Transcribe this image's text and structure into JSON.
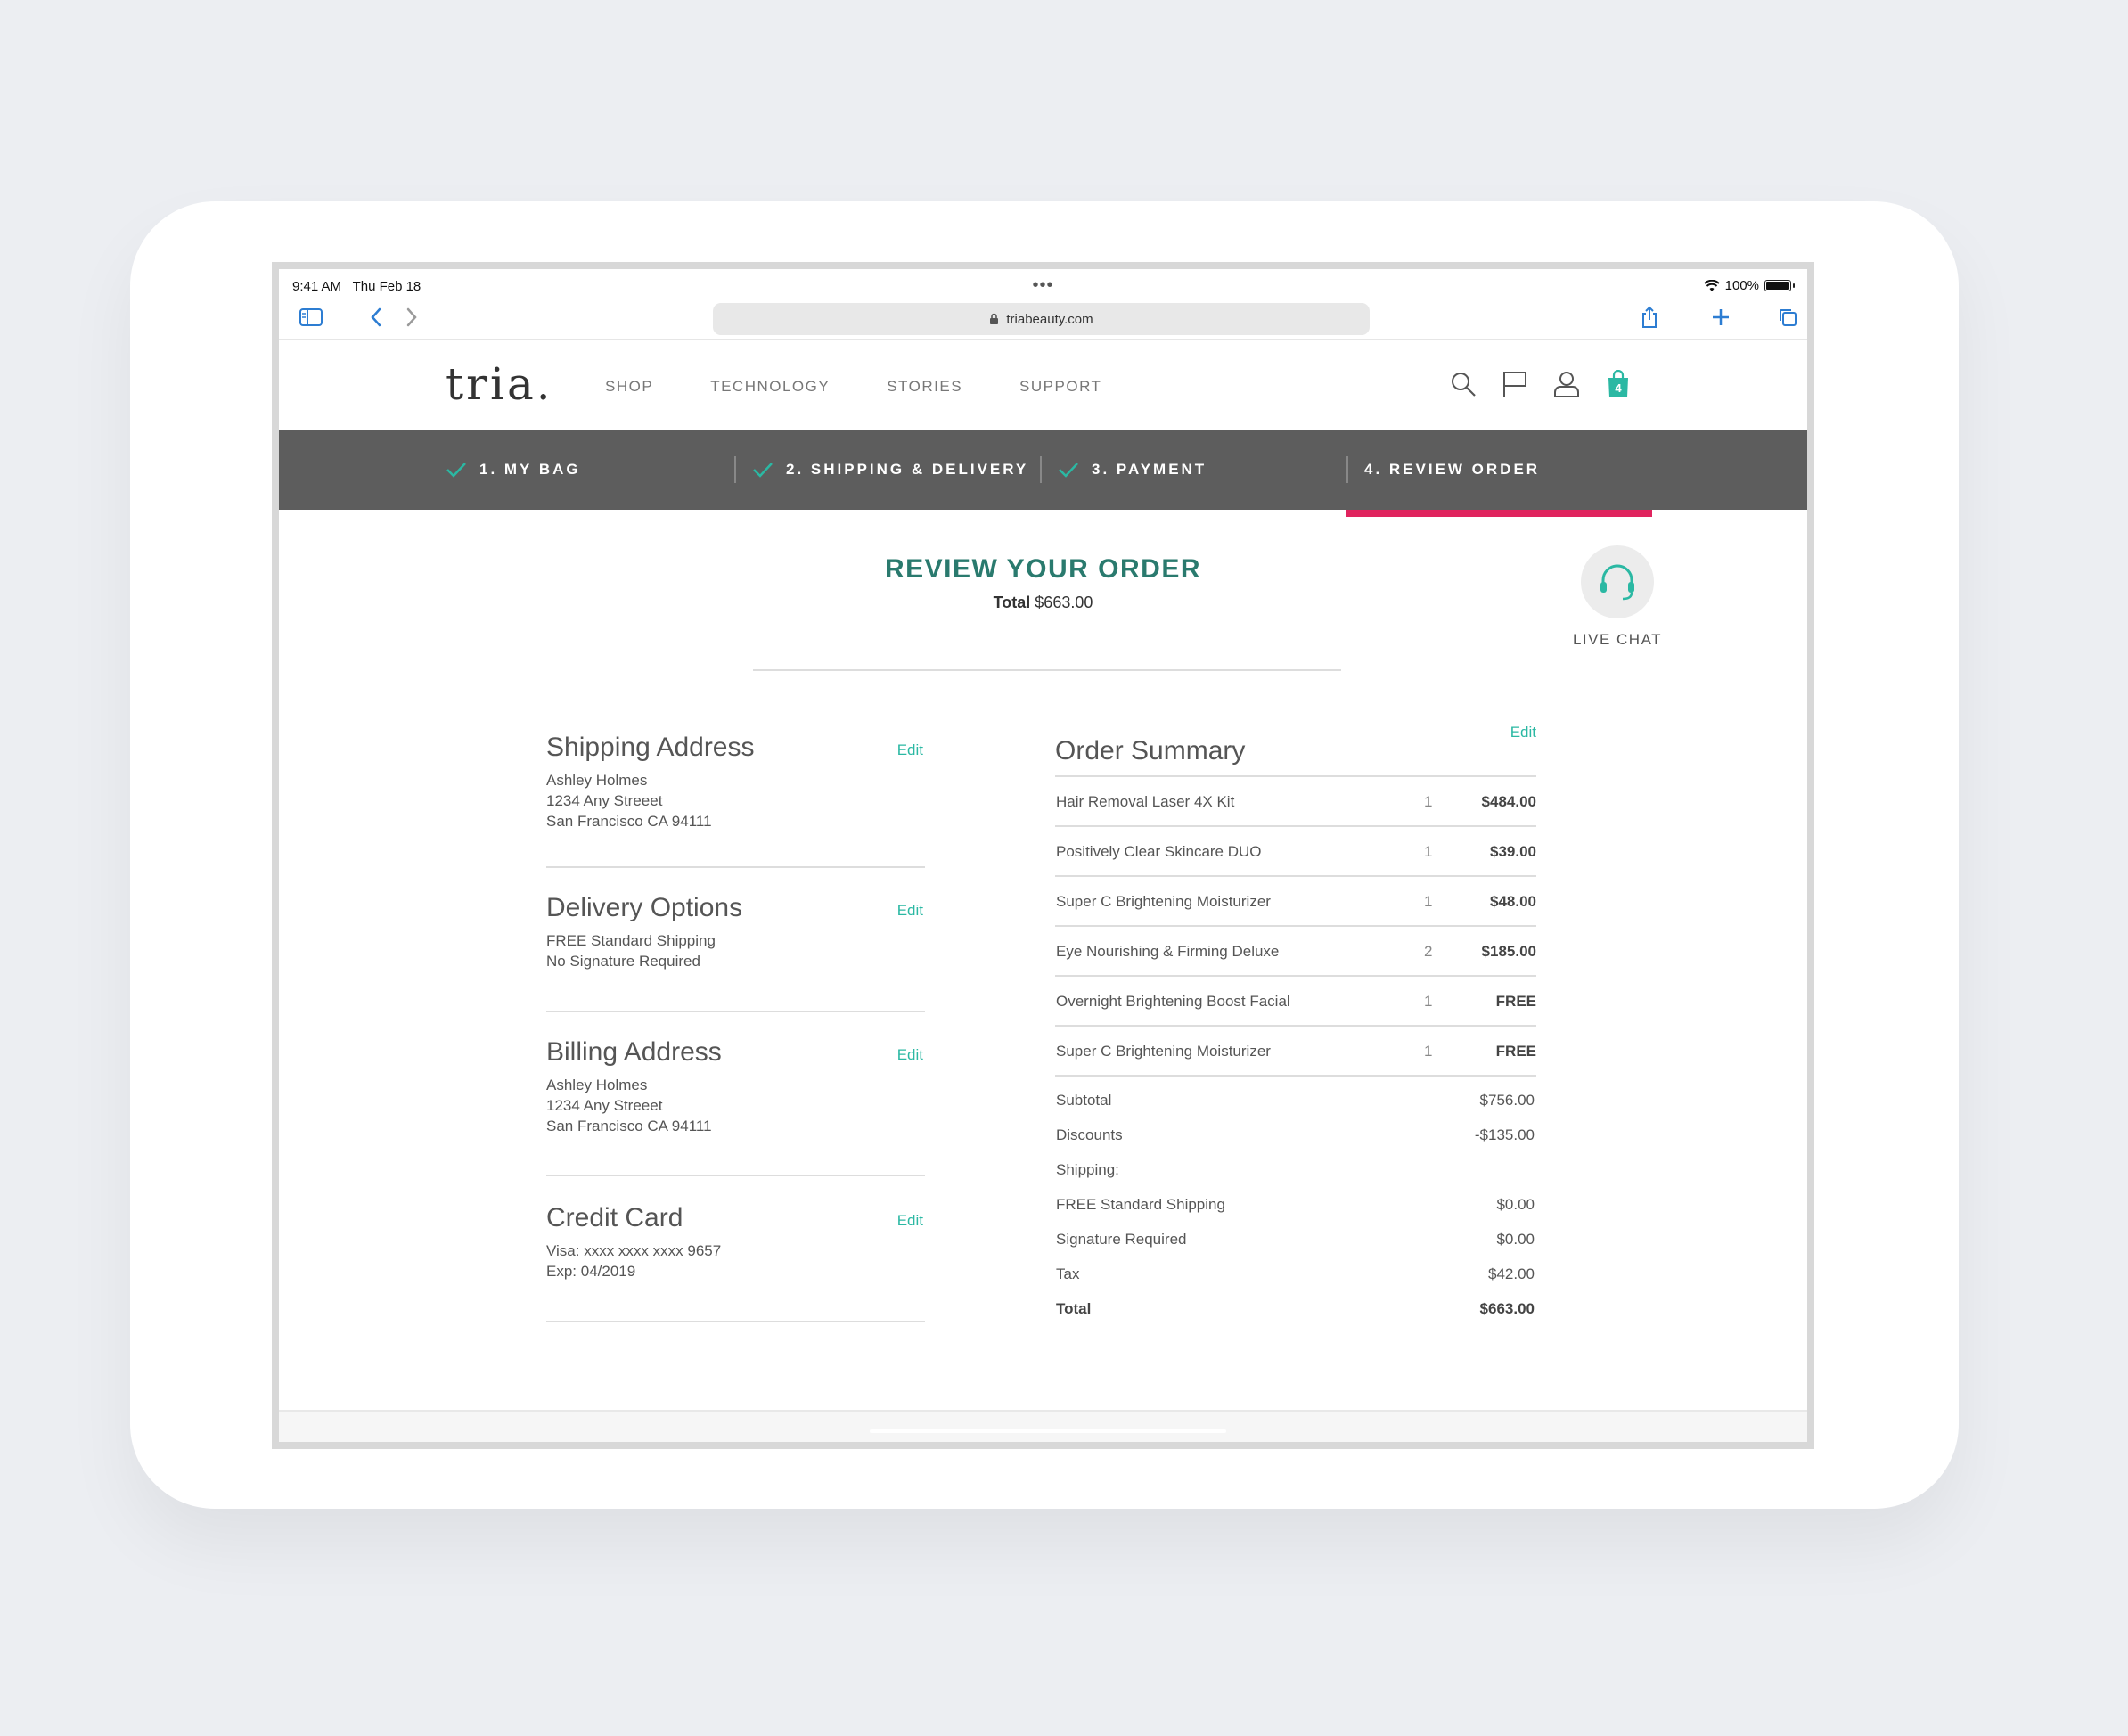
{
  "status": {
    "time": "9:41 AM",
    "date": "Thu Feb 18",
    "battery": "100%"
  },
  "browser": {
    "url": "triabeauty.com",
    "icons": [
      "sidebar-icon",
      "back-icon",
      "forward-icon",
      "share-icon",
      "plus-icon",
      "tabs-icon",
      "lock-icon"
    ]
  },
  "site": {
    "logo": "tria.",
    "nav": [
      "SHOP",
      "TECHNOLOGY",
      "STORIES",
      "SUPPORT"
    ],
    "icons": [
      "search-icon",
      "flag-icon",
      "account-icon",
      "bag-icon"
    ],
    "bag_count": "4"
  },
  "steps": [
    "1. MY BAG",
    "2. SHIPPING & DELIVERY",
    "3. PAYMENT",
    "4. REVIEW ORDER"
  ],
  "heading": {
    "title": "REVIEW YOUR ORDER",
    "total_label": "Total",
    "total_value": "$663.00"
  },
  "live_chat": "LIVE CHAT",
  "sections": {
    "shipping": {
      "title": "Shipping Address",
      "edit": "Edit",
      "lines": [
        "Ashley Holmes",
        "1234 Any Streeet",
        "San Francisco CA 94111"
      ]
    },
    "delivery": {
      "title": "Delivery Options",
      "edit": "Edit",
      "lines": [
        "FREE Standard Shipping",
        "No Signature Required"
      ]
    },
    "billing": {
      "title": "Billing Address",
      "edit": "Edit",
      "lines": [
        "Ashley Holmes",
        "1234 Any Streeet",
        "San Francisco CA 94111"
      ]
    },
    "card": {
      "title": "Credit Card",
      "edit": "Edit",
      "lines": [
        "Visa: xxxx xxxx xxxx  9657",
        "Exp: 04/2019"
      ]
    }
  },
  "summary": {
    "title": "Order Summary",
    "edit": "Edit",
    "items": [
      {
        "name": "Hair Removal Laser 4X Kit",
        "qty": "1",
        "price": "$484.00"
      },
      {
        "name": "Positively Clear Skincare DUO",
        "qty": "1",
        "price": "$39.00"
      },
      {
        "name": "Super C Brightening Moisturizer",
        "qty": "1",
        "price": "$48.00"
      },
      {
        "name": "Eye Nourishing & Firming Deluxe",
        "qty": "2",
        "price": "$185.00"
      },
      {
        "name": "Overnight Brightening Boost Facial",
        "qty": "1",
        "price": "FREE"
      },
      {
        "name": "Super C Brightening Moisturizer",
        "qty": "1",
        "price": "FREE"
      }
    ],
    "totals": [
      {
        "label": "Subtotal",
        "value": "$756.00"
      },
      {
        "label": "Discounts",
        "value": "-$135.00"
      },
      {
        "label": "Shipping:",
        "value": ""
      },
      {
        "label": "FREE Standard Shipping",
        "value": "$0.00"
      },
      {
        "label": "Signature Required",
        "value": "$0.00"
      },
      {
        "label": "Tax",
        "value": "$42.00"
      },
      {
        "label": "Total",
        "value": "$663.00"
      }
    ]
  },
  "colors": {
    "teal": "#2bb8a3",
    "accent": "#e0245e",
    "steps_bg": "#5d5d5d",
    "heading": "#2a7a6e"
  }
}
